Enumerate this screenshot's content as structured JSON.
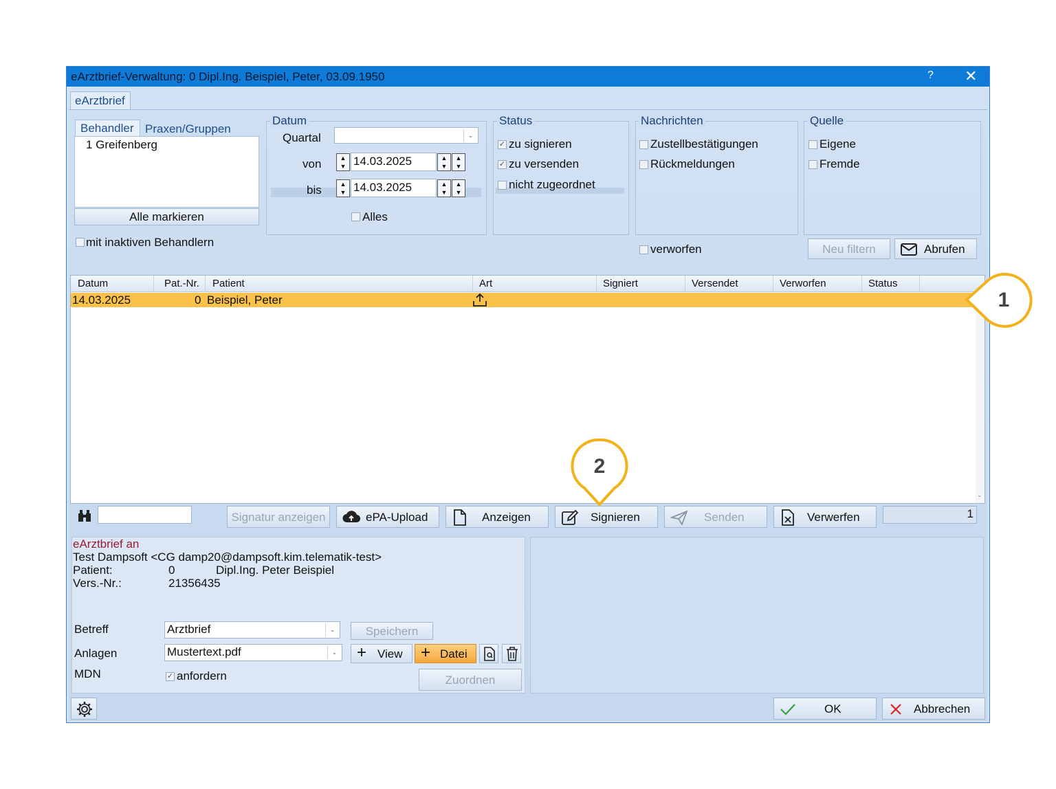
{
  "window": {
    "title": "eArztbrief-Verwaltung: 0 Dipl.Ing. Beispiel, Peter, 03.09.1950",
    "help": "?",
    "close": "✕"
  },
  "main_tab": "eArztbrief",
  "behandler": {
    "tabs": [
      "Behandler",
      "Praxen/Gruppen"
    ],
    "items": [
      "1 Greifenberg"
    ],
    "select_all": "Alle markieren",
    "inactive": "mit inaktiven Behandlern"
  },
  "datum": {
    "title": "Datum",
    "quartal_label": "Quartal",
    "quartal_value": "",
    "von_label": "von",
    "von_value": "14.03.2025",
    "bis_label": "bis",
    "bis_value": "14.03.2025",
    "alles": "Alles"
  },
  "status": {
    "title": "Status",
    "items": [
      {
        "label": "zu signieren",
        "checked": true
      },
      {
        "label": "zu versenden",
        "checked": true
      },
      {
        "label": "nicht zugeordnet",
        "checked": false
      }
    ]
  },
  "nachrichten": {
    "title": "Nachrichten",
    "items": [
      {
        "label": "Zustellbestätigungen",
        "checked": false
      },
      {
        "label": "Rückmeldungen",
        "checked": false
      }
    ],
    "verworfen": "verworfen"
  },
  "quelle": {
    "title": "Quelle",
    "items": [
      {
        "label": "Eigene",
        "checked": false
      },
      {
        "label": "Fremde",
        "checked": false
      }
    ]
  },
  "filter_buttons": {
    "neu_filtern": "Neu filtern",
    "abrufen": "Abrufen"
  },
  "table": {
    "columns": [
      "Datum",
      "Pat.-Nr.",
      "Patient",
      "Art",
      "Signiert",
      "Versendet",
      "Verworfen",
      "Status"
    ],
    "rows": [
      {
        "datum": "14.03.2025",
        "patnr": "0",
        "patient": "Beispiel, Peter",
        "art_icon": "upload-icon"
      }
    ]
  },
  "actions": {
    "search_value": "",
    "signatur_anzeigen": "Signatur anzeigen",
    "epa_upload": "ePA-Upload",
    "anzeigen": "Anzeigen",
    "signieren": "Signieren",
    "senden": "Senden",
    "verwerfen": "Verwerfen",
    "count": "1"
  },
  "detail": {
    "heading": "eArztbrief an",
    "recipient": "Test Dampsoft <CG damp20@dampsoft.kim.telematik-test>",
    "patient_label": "Patient:",
    "patient_nr": "0",
    "patient_name": "Dipl.Ing. Peter Beispiel",
    "vers_label": "Vers.-Nr.:",
    "vers_value": "21356435",
    "betreff_label": "Betreff",
    "betreff_value": "Arztbrief",
    "speichern": "Speichern",
    "anlagen_label": "Anlagen",
    "anlagen_value": "Mustertext.pdf",
    "view": "View",
    "datei": "Datei",
    "mdn_label": "MDN",
    "anfordern": "anfordern",
    "zuordnen": "Zuordnen"
  },
  "footer": {
    "ok": "OK",
    "abbrechen": "Abbrechen"
  },
  "callouts": [
    "1",
    "2"
  ],
  "colors": {
    "titlebar": "#0f7bd8",
    "selected_row": "#fbc24b",
    "callout": "#f2b21b",
    "heading_red": "#9b1b30"
  }
}
